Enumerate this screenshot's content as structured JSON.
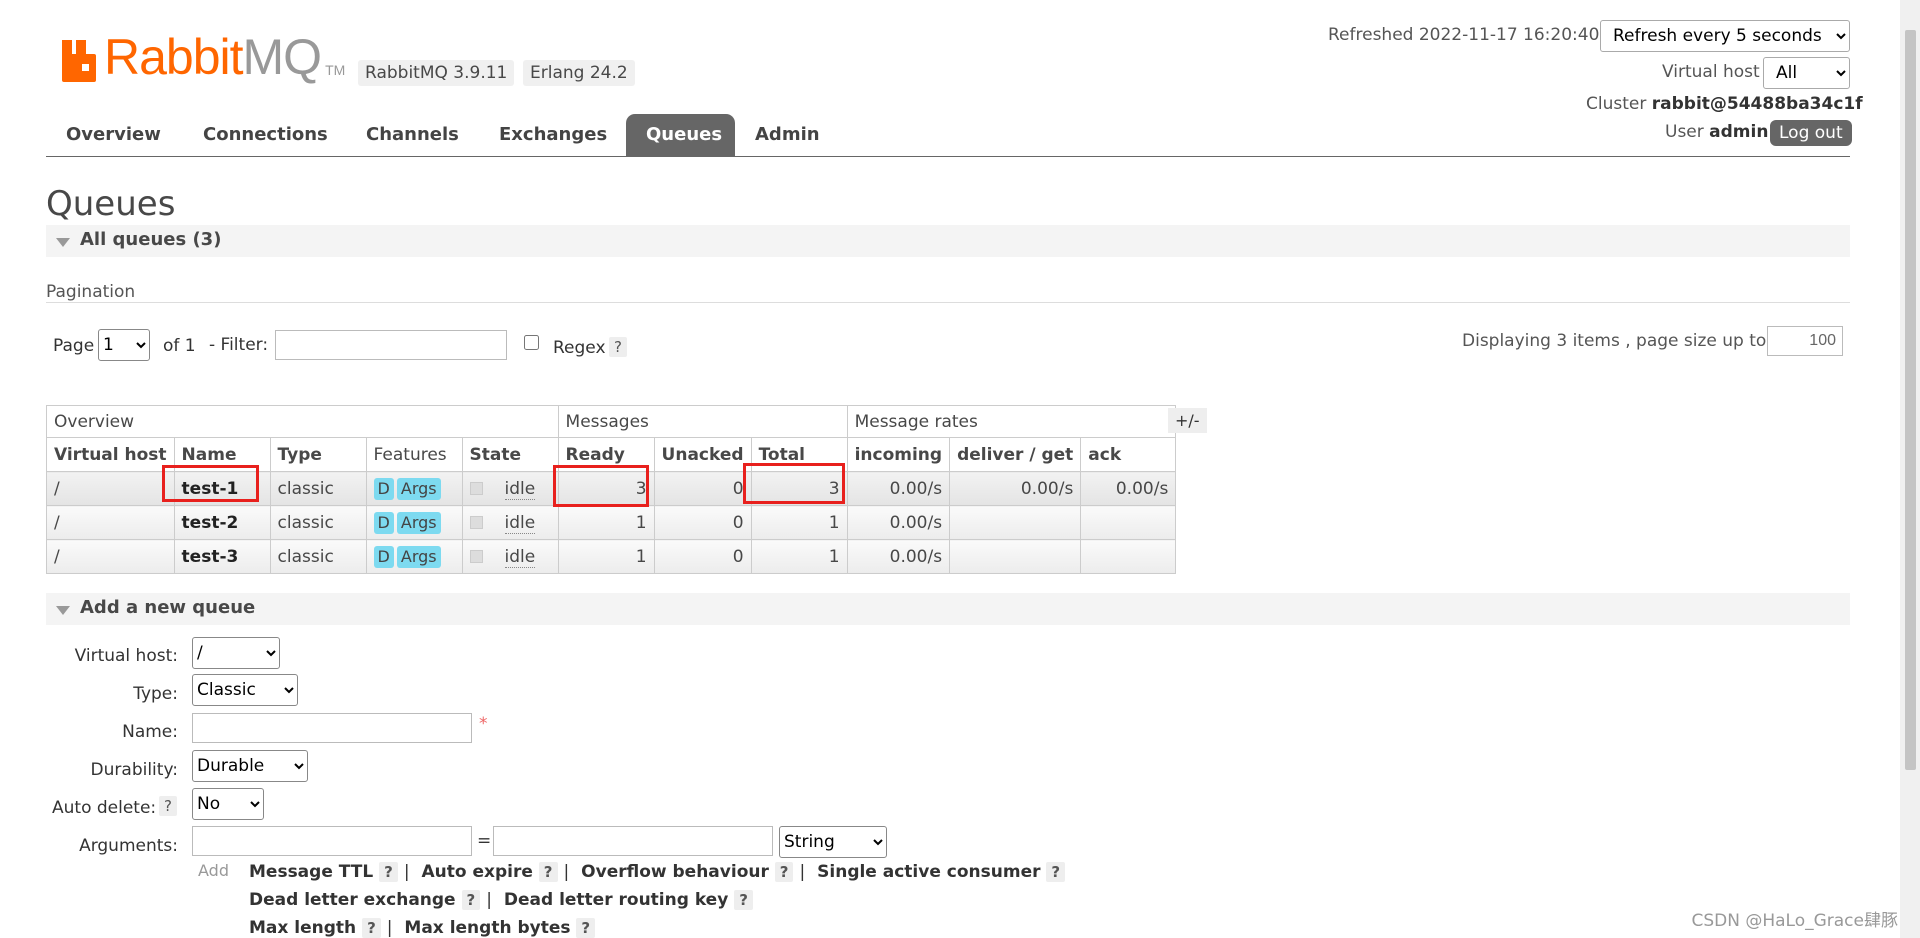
{
  "logo": {
    "brand_a": "Rabbit",
    "brand_b": "MQ",
    "tm": "TM"
  },
  "versions": {
    "rabbitmq": "RabbitMQ 3.9.11",
    "erlang": "Erlang 24.2"
  },
  "header": {
    "refreshed": "Refreshed 2022-11-17 16:20:40",
    "refresh_select": "Refresh every 5 seconds",
    "vhost_label": "Virtual host",
    "vhost_value": "All",
    "cluster_label": "Cluster",
    "cluster_value": "rabbit@54488ba34c1f",
    "user_label": "User",
    "user_value": "admin",
    "logout": "Log out"
  },
  "nav": [
    "Overview",
    "Connections",
    "Channels",
    "Exchanges",
    "Queues",
    "Admin"
  ],
  "page_title": "Queues",
  "all_queues": "All queues (3)",
  "pagination": {
    "label": "Pagination",
    "page_label": "Page",
    "page_value": "1",
    "of": "of 1",
    "filter_label": "- Filter:",
    "regex": "Regex",
    "help": "?",
    "displaying": "Displaying 3 items , page size up to:",
    "page_size": "100"
  },
  "table": {
    "groups": [
      "Overview",
      "Messages",
      "Message rates"
    ],
    "toggle": "+/-",
    "columns": [
      "Virtual host",
      "Name",
      "Type",
      "Features",
      "State",
      "Ready",
      "Unacked",
      "Total",
      "incoming",
      "deliver / get",
      "ack"
    ],
    "rows": [
      {
        "vhost": "/",
        "name": "test-1",
        "type": "classic",
        "f1": "D",
        "f2": "Args",
        "state": "idle",
        "ready": "3",
        "unacked": "0",
        "total": "3",
        "incoming": "0.00/s",
        "deliver": "0.00/s",
        "ack": "0.00/s"
      },
      {
        "vhost": "/",
        "name": "test-2",
        "type": "classic",
        "f1": "D",
        "f2": "Args",
        "state": "idle",
        "ready": "1",
        "unacked": "0",
        "total": "1",
        "incoming": "0.00/s",
        "deliver": "",
        "ack": ""
      },
      {
        "vhost": "/",
        "name": "test-3",
        "type": "classic",
        "f1": "D",
        "f2": "Args",
        "state": "idle",
        "ready": "1",
        "unacked": "0",
        "total": "1",
        "incoming": "0.00/s",
        "deliver": "",
        "ack": ""
      }
    ]
  },
  "add_queue": {
    "title": "Add a new queue",
    "vhost_label": "Virtual host:",
    "vhost_value": "/",
    "type_label": "Type:",
    "type_value": "Classic",
    "name_label": "Name:",
    "required": "*",
    "durability_label": "Durability:",
    "durability_value": "Durable",
    "autodelete_label": "Auto delete:",
    "autodelete_value": "No",
    "arguments_label": "Arguments:",
    "eq": "=",
    "arg_type": "String",
    "add": "Add",
    "links_row1": [
      "Message TTL",
      "Auto expire",
      "Overflow behaviour",
      "Single active consumer"
    ],
    "links_row2": [
      "Dead letter exchange",
      "Dead letter routing key"
    ],
    "links_row3": [
      "Max length",
      "Max length bytes"
    ]
  },
  "watermark": "CSDN @HaLo_Grace肆豚",
  "colors": {
    "brand": "#ff6600",
    "nav_active": "#666666",
    "highlight": "#e8201d",
    "badge": "#7ddaf0"
  }
}
